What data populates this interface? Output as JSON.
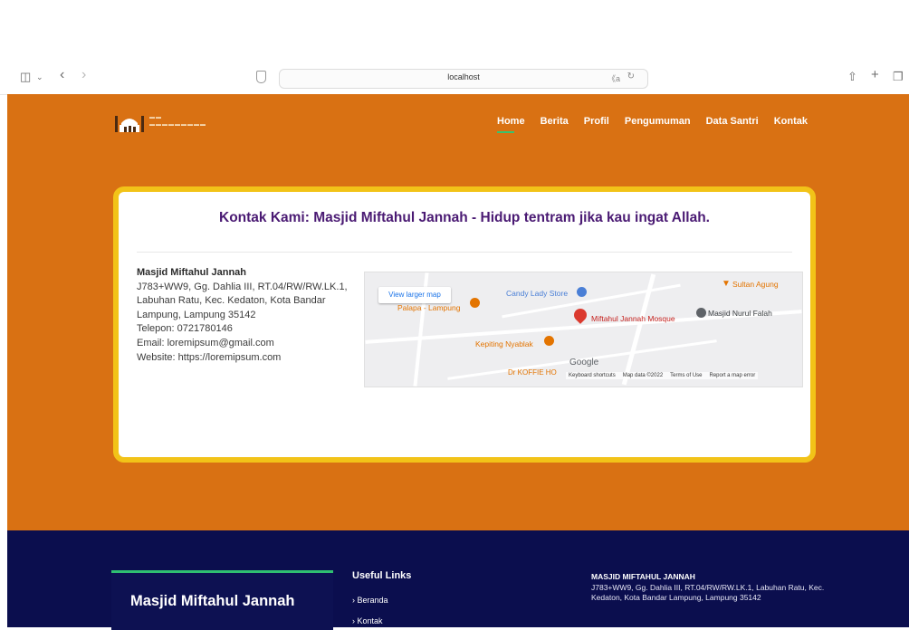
{
  "browser": {
    "url": "localhost"
  },
  "site": {
    "nav": [
      "Home",
      "Berita",
      "Profil",
      "Pengumuman",
      "Data Santri",
      "Kontak"
    ],
    "active_nav": "Home"
  },
  "contact_card": {
    "heading": "Kontak Kami: Masjid Miftahul Jannah - Hidup tentram jika kau ingat Allah.",
    "name": "Masjid Miftahul Jannah",
    "address": "J783+WW9, Gg. Dahlia III, RT.04/RW/RW.LK.1, Labuhan Ratu, Kec. Kedaton, Kota Bandar Lampung, Lampung 35142",
    "phone": "Telepon: 0721780146",
    "email": "Email: loremipsum@gmail.com",
    "website": "Website: https://loremipsum.com"
  },
  "map": {
    "view_larger": "View larger map",
    "places": {
      "candy": "Candy Lady Store",
      "sultan": "Sultan Agung",
      "palapa": "Palapa - Lampung",
      "miftahul": "Miftahul Jannah Mosque",
      "nurul": "Masjid Nurul Falah",
      "kepiting": "Kepiting Nyablak",
      "koffie": "Dr KOFFIE HO"
    },
    "google": "Google",
    "footer": [
      "Keyboard shortcuts",
      "Map data ©2022",
      "Terms of Use",
      "Report a map error"
    ]
  },
  "footer": {
    "brand": "Masjid Miftahul Jannah",
    "links_heading": "Useful Links",
    "links": [
      "Beranda",
      "Kontak"
    ],
    "contact_heading": "MASJID MIFTAHUL JANNAH",
    "contact_address": "J783+WW9, Gg. Dahlia III, RT.04/RW/RW.LK.1, Labuhan Ratu, Kec. Kedaton, Kota Bandar Lampung, Lampung 35142"
  },
  "colors": {
    "hero": "#d97113",
    "card_border": "#f2c318",
    "heading": "#4a1a73",
    "footer": "#0b0e4e",
    "accent": "#2fbf71"
  }
}
